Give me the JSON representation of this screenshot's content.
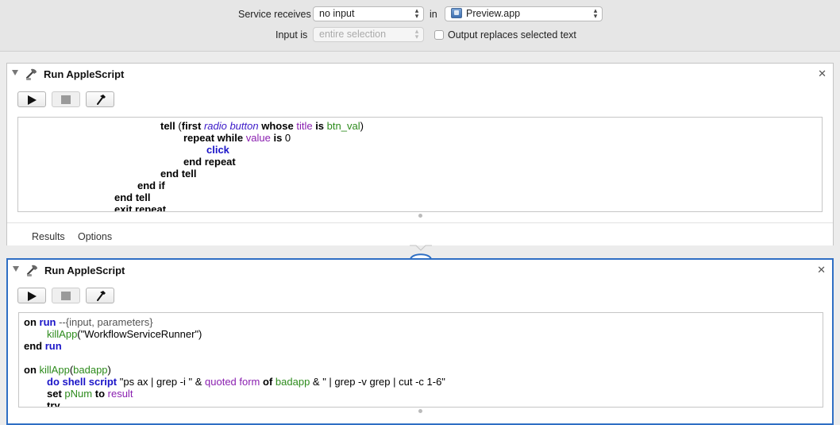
{
  "header": {
    "service_receives_label": "Service receives",
    "service_receives_value": "no input",
    "in_label": "in",
    "app_value": "Preview.app",
    "input_is_label": "Input is",
    "input_is_value": "entire selection",
    "output_replaces_label": "Output replaces selected text"
  },
  "actions": [
    {
      "title": "Run AppleScript",
      "tabs": [
        "Results",
        "Options"
      ]
    },
    {
      "title": "Run AppleScript"
    }
  ],
  "code1": [
    [
      {
        "t": "tell",
        "c": "k"
      },
      {
        "t": " (",
        "c": "bk"
      },
      {
        "t": "first",
        "c": "k"
      },
      {
        "t": " ",
        "c": "bk"
      },
      {
        "t": "radio button",
        "c": "it"
      },
      {
        "t": " ",
        "c": "bk"
      },
      {
        "t": "whose",
        "c": "k"
      },
      {
        "t": " ",
        "c": "bk"
      },
      {
        "t": "title",
        "c": "pu"
      },
      {
        "t": " ",
        "c": "bk"
      },
      {
        "t": "is",
        "c": "k"
      },
      {
        "t": " ",
        "c": "bk"
      },
      {
        "t": "btn_val",
        "c": "gr"
      },
      {
        "t": ")",
        "c": "bk"
      }
    ],
    [
      {
        "t": "repeat while",
        "c": "k"
      },
      {
        "t": " ",
        "c": "bk"
      },
      {
        "t": "value",
        "c": "pu"
      },
      {
        "t": " ",
        "c": "bk"
      },
      {
        "t": "is",
        "c": "k"
      },
      {
        "t": " 0",
        "c": "bk"
      }
    ],
    [
      {
        "t": "click",
        "c": "kb"
      }
    ],
    [
      {
        "t": "end repeat",
        "c": "k"
      }
    ],
    [
      {
        "t": "end tell",
        "c": "k"
      }
    ],
    [
      {
        "t": "end if",
        "c": "k"
      }
    ],
    [
      {
        "t": "end tell",
        "c": "k"
      }
    ],
    [
      {
        "t": "exit repeat",
        "c": "k"
      }
    ]
  ],
  "code2": [
    [
      {
        "t": "on",
        "c": "k"
      },
      {
        "t": " ",
        "c": "bk"
      },
      {
        "t": "run",
        "c": "kb"
      },
      {
        "t": " --{input, parameters}",
        "c": "cm"
      }
    ],
    [
      {
        "t": "killApp",
        "c": "gr"
      },
      {
        "t": "(\"WorkflowServiceRunner\")",
        "c": "bk"
      }
    ],
    [
      {
        "t": "end",
        "c": "k"
      },
      {
        "t": " ",
        "c": "bk"
      },
      {
        "t": "run",
        "c": "kb"
      }
    ],
    [],
    [
      {
        "t": "on",
        "c": "k"
      },
      {
        "t": " ",
        "c": "bk"
      },
      {
        "t": "killApp",
        "c": "gr"
      },
      {
        "t": "(",
        "c": "bk"
      },
      {
        "t": "badapp",
        "c": "gr"
      },
      {
        "t": ")",
        "c": "bk"
      }
    ],
    [
      {
        "t": "do shell script",
        "c": "kb"
      },
      {
        "t": " \"ps ax | grep -i \" & ",
        "c": "bk"
      },
      {
        "t": "quoted form",
        "c": "pu"
      },
      {
        "t": " ",
        "c": "bk"
      },
      {
        "t": "of",
        "c": "k"
      },
      {
        "t": " ",
        "c": "bk"
      },
      {
        "t": "badapp",
        "c": "gr"
      },
      {
        "t": " & \" | grep -v grep | cut -c 1-6\"",
        "c": "bk"
      }
    ],
    [
      {
        "t": "set",
        "c": "k"
      },
      {
        "t": " ",
        "c": "bk"
      },
      {
        "t": "pNum",
        "c": "gr"
      },
      {
        "t": " ",
        "c": "bk"
      },
      {
        "t": "to",
        "c": "k"
      },
      {
        "t": " ",
        "c": "bk"
      },
      {
        "t": "result",
        "c": "pu"
      }
    ],
    [
      {
        "t": "try",
        "c": "k"
      }
    ]
  ]
}
